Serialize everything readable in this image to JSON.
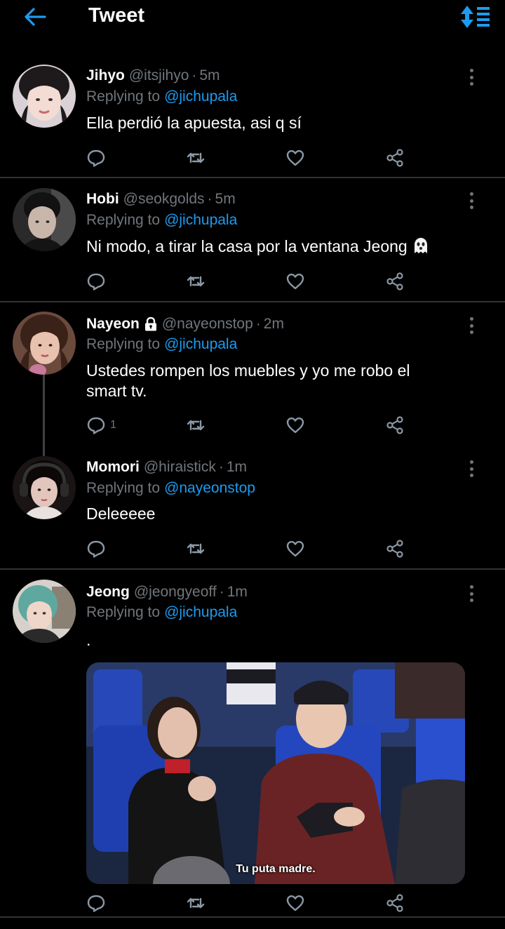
{
  "header": {
    "title": "Tweet",
    "back_icon": "arrow-left-icon",
    "sort_icon": "sort-icon",
    "accent": "#1d9bf0"
  },
  "colors": {
    "background": "#000000",
    "secondary_text": "#71767b",
    "link": "#1d9bf0",
    "divider": "#2f3336"
  },
  "tweets": [
    {
      "name": "Jihyo",
      "handle": "@itsjihyo",
      "separator": "·",
      "time": "5m",
      "replying_prefix": "Replying to",
      "replying_to": "@jichupala",
      "text": "Ella perdió la apuesta, asi q sí"
    },
    {
      "name": "Hobi",
      "handle": "@seokgolds",
      "separator": "·",
      "time": "5m",
      "replying_prefix": "Replying to",
      "replying_to": "@jichupala",
      "text": "Ni modo, a tirar la casa por la ventana Jeong",
      "emoji": "ghost-emoji"
    },
    {
      "name": "Nayeon",
      "locked": true,
      "handle": "@nayeonstop",
      "separator": "·",
      "time": "2m",
      "replying_prefix": "Replying to",
      "replying_to": "@jichupala",
      "text_line1": "Ustedes rompen los muebles y yo me robo el",
      "text_line2": "smart tv.",
      "reply_count": "1"
    },
    {
      "name": "Momori",
      "handle": "@hiraistick",
      "separator": "·",
      "time": "1m",
      "replying_prefix": "Replying to",
      "replying_to": "@nayeonstop",
      "text": "Deleeeee"
    },
    {
      "name": "Jeong",
      "handle": "@jeongyeoff",
      "separator": "·",
      "time": "1m",
      "replying_prefix": "Replying to",
      "replying_to": "@jichupala",
      "text": ".",
      "media_subtitle": "Tu puta madre."
    }
  ],
  "action_icons": [
    "reply-icon",
    "retweet-icon",
    "like-icon",
    "share-icon"
  ]
}
